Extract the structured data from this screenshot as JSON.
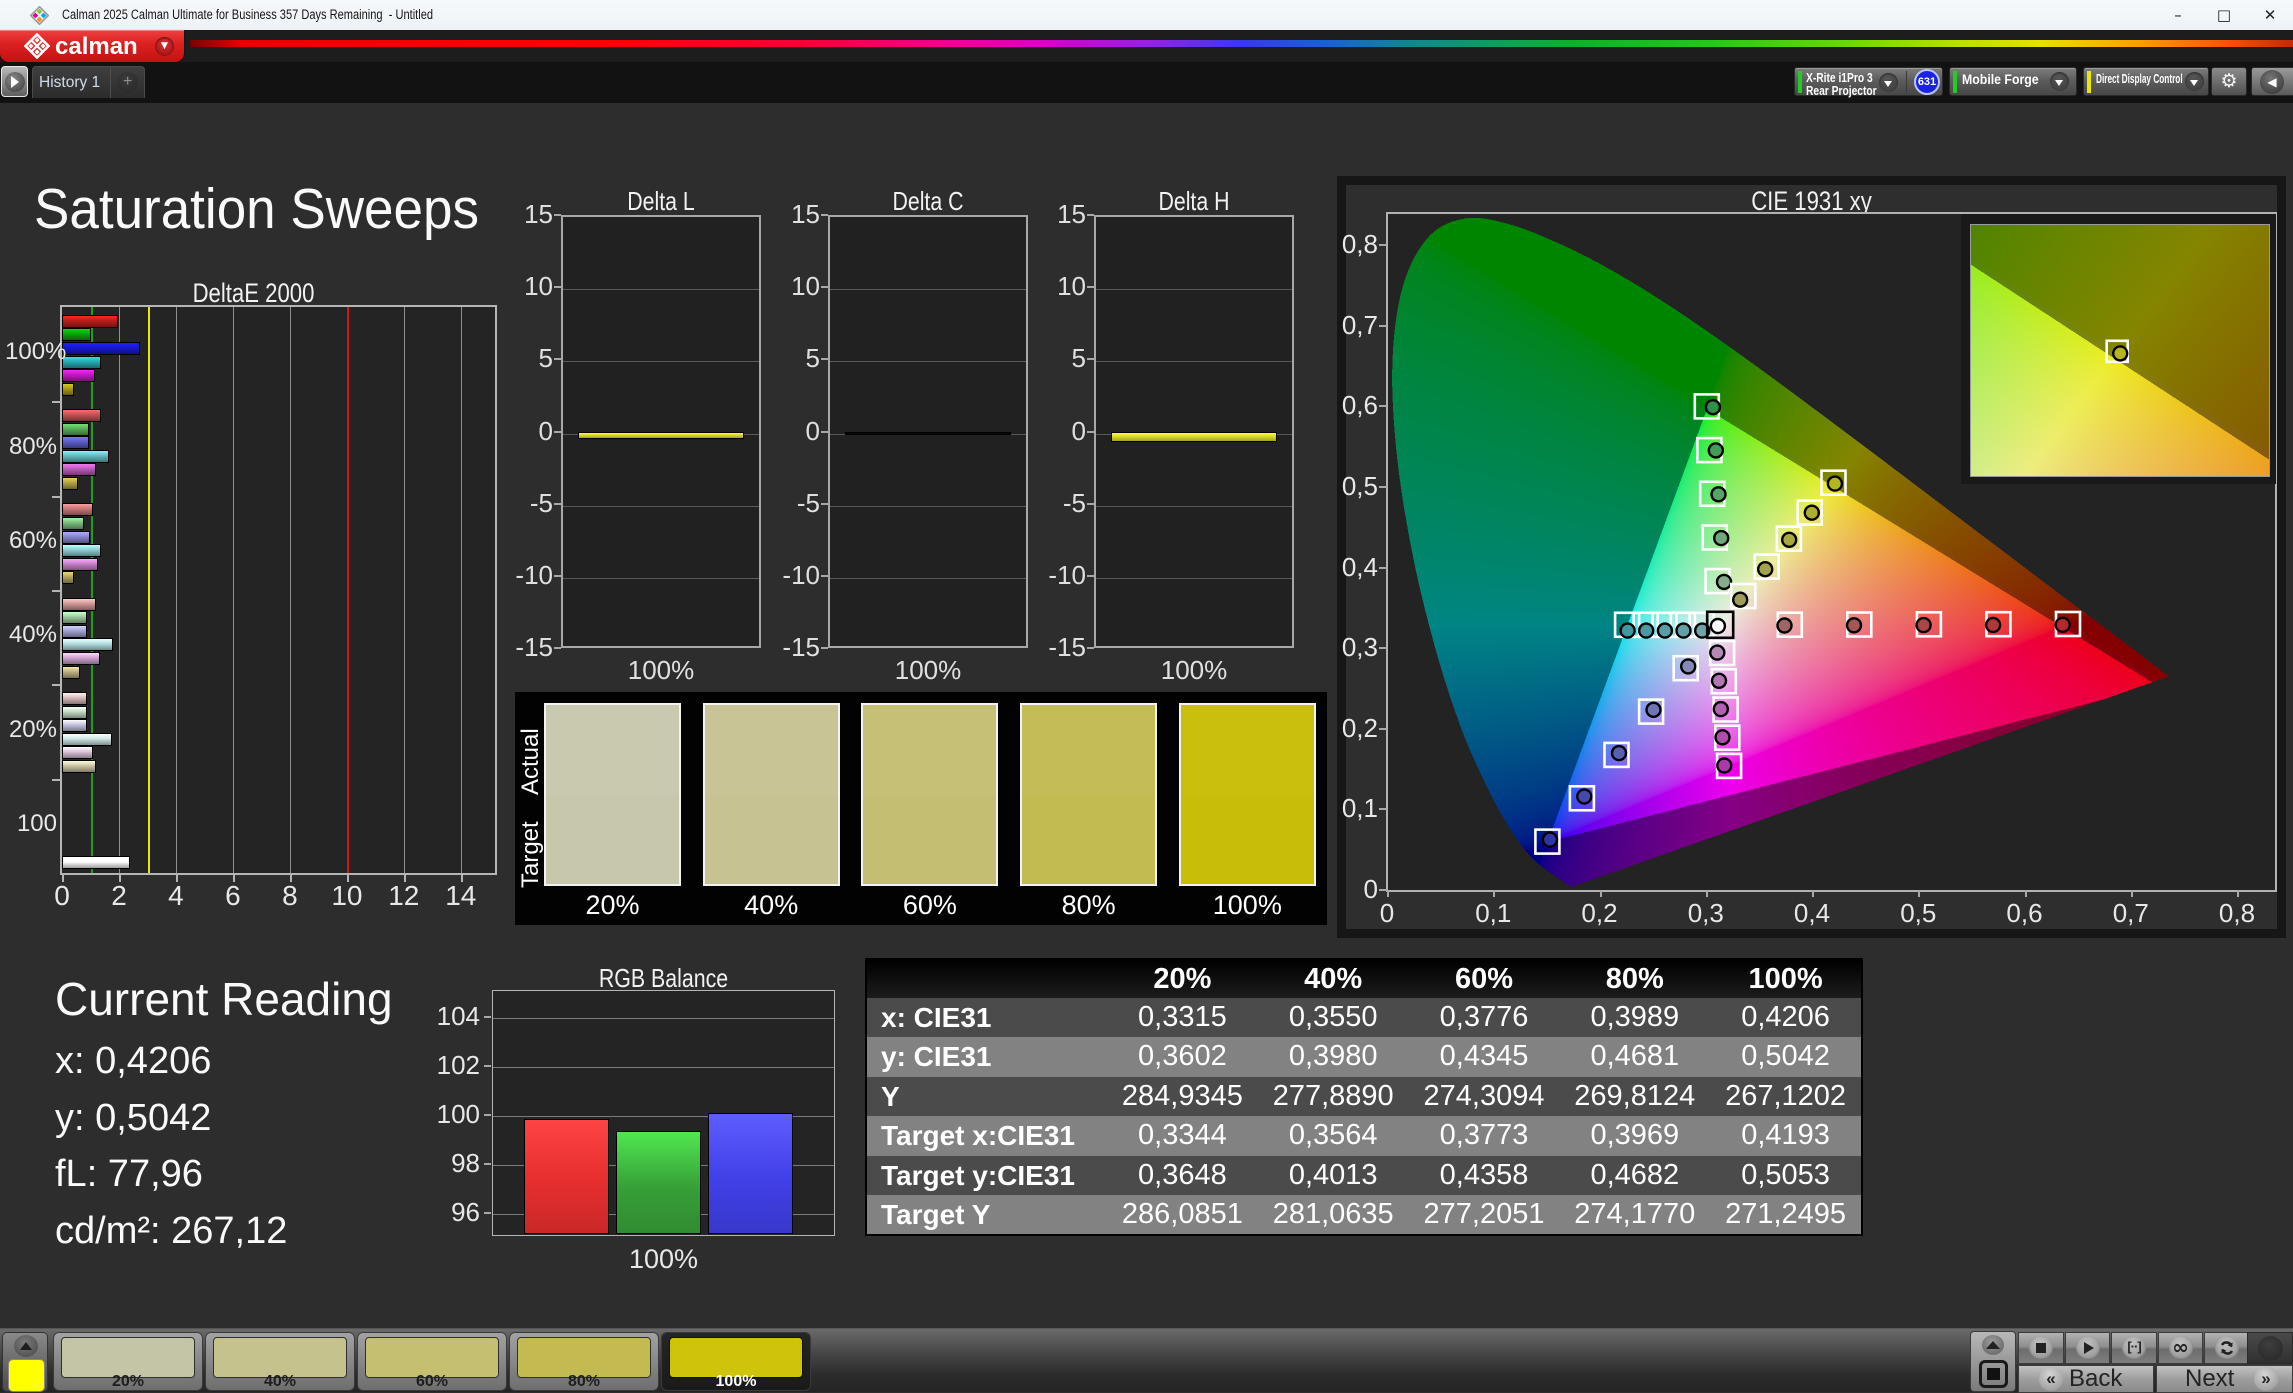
{
  "window": {
    "title": "Calman 2025 Calman Ultimate for Business 357 Days Remaining  - Untitled",
    "controls": [
      {
        "name": "minimize",
        "glyph": "–"
      },
      {
        "name": "maximize",
        "glyph": "□"
      },
      {
        "name": "close",
        "glyph": "✕"
      }
    ]
  },
  "brand": {
    "label": "calman"
  },
  "tabs": {
    "history": "History 1",
    "add": "+"
  },
  "toolbar": {
    "meter": {
      "line1": "X-Rite i1Pro 3",
      "line2": "Rear Projector",
      "status_color": "#22cc22"
    },
    "badge": "631",
    "source": {
      "label": "Mobile Forge",
      "status_color": "#22cc22"
    },
    "display_control": {
      "label": "Direct Display Control",
      "status_color": "#e8e800"
    }
  },
  "page": {
    "title": "Saturation Sweeps"
  },
  "reading": {
    "title": "Current Reading",
    "lines": [
      "x: 0,4206",
      "y: 0,5042",
      "fL: 77,96",
      "cd/m²: 267,12"
    ]
  },
  "chart_data": [
    {
      "id": "deltae2000",
      "type": "bar",
      "title": "DeltaE 2000",
      "orientation": "horizontal",
      "xlim": [
        0,
        15.2
      ],
      "xticks": [
        0,
        2,
        4,
        6,
        8,
        10,
        12,
        14
      ],
      "reference_lines": [
        {
          "value": 1,
          "color": "#1ca01c"
        },
        {
          "value": 3,
          "color": "#e8e800"
        },
        {
          "value": 10,
          "color": "#d01616"
        }
      ],
      "groups": [
        {
          "label": "100%",
          "values": [
            1.95,
            1.0,
            2.75,
            1.38,
            1.15,
            0.42
          ],
          "colors": [
            "#c01d1d",
            "#0ca40c",
            "#1818d0",
            "#28aab2",
            "#bd1dbd",
            "#a89c14"
          ]
        },
        {
          "label": "80%",
          "values": [
            1.35,
            0.93,
            0.93,
            1.64,
            1.2,
            0.55
          ],
          "colors": [
            "#c25353",
            "#58ae58",
            "#5c5cc8",
            "#63bdc2",
            "#bc5cbc",
            "#b3a242"
          ]
        },
        {
          "label": "60%",
          "values": [
            1.1,
            0.78,
            0.99,
            1.35,
            1.27,
            0.42
          ],
          "colors": [
            "#c87878",
            "#7cbc7c",
            "#8686cf",
            "#8fd0d3",
            "#c983c9",
            "#b5a75e"
          ]
        },
        {
          "label": "40%",
          "values": [
            1.19,
            0.88,
            0.86,
            1.79,
            1.32,
            0.62
          ],
          "colors": [
            "#cf9898",
            "#9ecb9e",
            "#a3a3d6",
            "#b4dee0",
            "#d3a6d3",
            "#bdb283"
          ]
        },
        {
          "label": "20%",
          "values": [
            0.89,
            0.86,
            0.89,
            1.76,
            1.07,
            1.19
          ],
          "colors": [
            "#d9bcbc",
            "#c2dbc2",
            "#c3c3e0",
            "#cfe8e8",
            "#dcc5dc",
            "#cdc5a4"
          ]
        },
        {
          "label": "100",
          "values": [
            2.37
          ],
          "colors": [
            "#ffffff"
          ]
        }
      ]
    },
    {
      "id": "delta_l",
      "type": "bar",
      "title": "Delta L",
      "categories": [
        "100%"
      ],
      "values": [
        -0.5
      ],
      "bar_color": "#cbcb2a",
      "ylim": [
        -15,
        15
      ],
      "yticks": [
        15,
        10,
        5,
        0,
        -5,
        -10,
        -15
      ]
    },
    {
      "id": "delta_c",
      "type": "bar",
      "title": "Delta C",
      "categories": [
        "100%"
      ],
      "values": [
        -0.07
      ],
      "bar_color": "#0a0a0a",
      "ylim": [
        -15,
        15
      ],
      "yticks": [
        15,
        10,
        5,
        0,
        -5,
        -10,
        -15
      ]
    },
    {
      "id": "delta_h",
      "type": "bar",
      "title": "Delta H",
      "categories": [
        "100%"
      ],
      "values": [
        -0.72
      ],
      "bar_color": "#cbcb2a",
      "ylim": [
        -15,
        15
      ],
      "yticks": [
        15,
        10,
        5,
        0,
        -5,
        -10,
        -15
      ]
    },
    {
      "id": "cie",
      "type": "scatter",
      "title": "CIE 1931 xy",
      "xticks": [
        "0",
        "0,1",
        "0,2",
        "0,3",
        "0,4",
        "0,5",
        "0,6",
        "0,7",
        "0,8"
      ],
      "yticks": [
        "0",
        "0,1",
        "0,2",
        "0,3",
        "0,4",
        "0,5",
        "0,6",
        "0,7",
        "0,8"
      ],
      "white_point": {
        "target": [
          0.3127,
          0.329
        ],
        "measured": [
          0.3105,
          0.3275
        ],
        "fill": "#ffffff"
      },
      "gamut_triangle": [
        [
          0.3,
          0.597
        ],
        [
          0.15,
          0.06
        ],
        [
          0.724,
          0.254
        ]
      ],
      "sweeps": [
        {
          "name": "red",
          "primary": [
            0.64,
            0.33
          ],
          "targets": [
            [
              0.3782,
              0.3292
            ],
            [
              0.4436,
              0.3294
            ],
            [
              0.5091,
              0.3296
            ],
            [
              0.5745,
              0.3298
            ],
            [
              0.64,
              0.33
            ]
          ],
          "measured": [
            [
              0.3732,
              0.3282
            ],
            [
              0.4386,
              0.3284
            ],
            [
              0.5041,
              0.3286
            ],
            [
              0.5695,
              0.3288
            ],
            [
              0.635,
              0.329
            ]
          ],
          "dot_colors": [
            "#a06666",
            "#a65656",
            "#ab4646",
            "#b03838",
            "#b42a2a"
          ]
        },
        {
          "name": "green",
          "primary": [
            0.3,
            0.6
          ],
          "targets": [
            [
              0.3102,
              0.3832
            ],
            [
              0.3076,
              0.4374
            ],
            [
              0.3051,
              0.4916
            ],
            [
              0.3025,
              0.5458
            ],
            [
              0.3,
              0.6
            ]
          ],
          "measured": [
            [
              0.3162,
              0.3822
            ],
            [
              0.3136,
              0.4366
            ],
            [
              0.3111,
              0.491
            ],
            [
              0.3085,
              0.5454
            ],
            [
              0.3058,
              0.599
            ]
          ],
          "dot_colors": [
            "#84ad8c",
            "#6fa87a",
            "#58a367",
            "#459c56",
            "#2f9246"
          ]
        },
        {
          "name": "blue",
          "primary": [
            0.15,
            0.06
          ],
          "targets": [
            [
              0.2802,
              0.2752
            ],
            [
              0.2476,
              0.2214
            ],
            [
              0.2151,
              0.1676
            ],
            [
              0.1825,
              0.1138
            ],
            [
              0.15,
              0.06
            ]
          ],
          "measured": [
            [
              0.2825,
              0.2774
            ],
            [
              0.2499,
              0.2236
            ],
            [
              0.2174,
              0.1698
            ],
            [
              0.1848,
              0.116
            ],
            [
              0.1525,
              0.0625
            ]
          ],
          "dot_colors": [
            "#8489b8",
            "#6f74b4",
            "#5a60b0",
            "#4549ab",
            "#3136a6"
          ]
        },
        {
          "name": "cyan",
          "primary": [
            0.225,
            0.329
          ],
          "targets": [
            [
              0.2952,
              0.329
            ],
            [
              0.2776,
              0.329
            ],
            [
              0.2601,
              0.329
            ],
            [
              0.2425,
              0.329
            ],
            [
              0.225,
              0.329
            ]
          ],
          "measured": [
            [
              0.2957,
              0.3218
            ],
            [
              0.2781,
              0.3218
            ],
            [
              0.2606,
              0.3218
            ],
            [
              0.243,
              0.3218
            ],
            [
              0.2255,
              0.3218
            ]
          ],
          "dot_colors": [
            "#6fa3a8",
            "#63a0a6",
            "#579da4",
            "#4b9aa2",
            "#3f97a0"
          ]
        },
        {
          "name": "magenta",
          "primary": [
            0.321,
            0.154
          ],
          "targets": [
            [
              0.3144,
              0.294
            ],
            [
              0.316,
              0.259
            ],
            [
              0.3177,
              0.224
            ],
            [
              0.3193,
              0.189
            ],
            [
              0.321,
              0.154
            ]
          ],
          "measured": [
            [
              0.3099,
              0.2945
            ],
            [
              0.3115,
              0.2595
            ],
            [
              0.3132,
              0.2245
            ],
            [
              0.3148,
              0.1895
            ],
            [
              0.3165,
              0.1545
            ]
          ],
          "dot_colors": [
            "#b48ab4",
            "#b276b2",
            "#b062b0",
            "#ae4ead",
            "#ac39a9"
          ]
        },
        {
          "name": "yellow",
          "primary": [
            0.4193,
            0.5053
          ],
          "targets": [
            [
              0.3344,
              0.3648
            ],
            [
              0.3564,
              0.4013
            ],
            [
              0.3773,
              0.4358
            ],
            [
              0.3969,
              0.4682
            ],
            [
              0.4193,
              0.5053
            ]
          ],
          "measured": [
            [
              0.3315,
              0.3602
            ],
            [
              0.355,
              0.398
            ],
            [
              0.3776,
              0.4345
            ],
            [
              0.3989,
              0.4681
            ],
            [
              0.4206,
              0.5042
            ]
          ],
          "dot_colors": [
            "#9d9d58",
            "#a3a34b",
            "#a8a83e",
            "#aeae30",
            "#b5b520"
          ]
        }
      ],
      "inset": {
        "x_range": [
          0.3555,
          0.4855
        ],
        "y_range": [
          0.438,
          0.5735
        ],
        "target": [
          0.4193,
          0.5053
        ],
        "measured": [
          0.4206,
          0.5042
        ]
      }
    },
    {
      "id": "swatches",
      "type": "table",
      "row_labels": [
        "Actual",
        "Target"
      ],
      "categories": [
        "20%",
        "40%",
        "60%",
        "80%",
        "100%"
      ],
      "actual_colors": [
        "#c9c9b0",
        "#c8c496",
        "#c6c077",
        "#c4bd57",
        "#cabf0c"
      ],
      "target_colors": [
        "#c7c7ac",
        "#c6c292",
        "#c4be73",
        "#c2bb52",
        "#c8bd08"
      ]
    },
    {
      "id": "rgb_balance",
      "type": "bar",
      "title": "RGB Balance",
      "categories": [
        "100%"
      ],
      "series": [
        {
          "name": "Red",
          "values": [
            99.9
          ],
          "color": "#e62e2e"
        },
        {
          "name": "Green",
          "values": [
            99.4
          ],
          "color": "#379f37"
        },
        {
          "name": "Blue",
          "values": [
            100.15
          ],
          "color": "#4040e8"
        }
      ],
      "ylim": [
        95.2,
        105.1
      ],
      "yticks": [
        104,
        102,
        100,
        98,
        96
      ]
    },
    {
      "id": "data_table",
      "type": "table",
      "columns": [
        "",
        "20%",
        "40%",
        "60%",
        "80%",
        "100%"
      ],
      "rows": [
        {
          "label": "x: CIE31",
          "values": [
            "0,3315",
            "0,3550",
            "0,3776",
            "0,3989",
            "0,4206"
          ]
        },
        {
          "label": "y: CIE31",
          "values": [
            "0,3602",
            "0,3980",
            "0,4345",
            "0,4681",
            "0,5042"
          ]
        },
        {
          "label": "Y",
          "values": [
            "284,9345",
            "277,8890",
            "274,3094",
            "269,8124",
            "267,1202"
          ]
        },
        {
          "label": "Target x:CIE31",
          "values": [
            "0,3344",
            "0,3564",
            "0,3773",
            "0,3969",
            "0,4193"
          ]
        },
        {
          "label": "Target y:CIE31",
          "values": [
            "0,3648",
            "0,4013",
            "0,4358",
            "0,4682",
            "0,5053"
          ]
        },
        {
          "label": "Target Y",
          "values": [
            "286,0851",
            "281,0635",
            "277,2051",
            "274,1770",
            "271,2495"
          ]
        }
      ]
    }
  ],
  "bottom": {
    "patch_color": "#ffff00",
    "slides": [
      {
        "label": "20%",
        "color": "#c4c4a7",
        "selected": false
      },
      {
        "label": "40%",
        "color": "#c5c28e",
        "selected": false
      },
      {
        "label": "60%",
        "color": "#c5bf72",
        "selected": false
      },
      {
        "label": "80%",
        "color": "#c3bb52",
        "selected": false
      },
      {
        "label": "100%",
        "color": "#cfc409",
        "selected": true
      }
    ],
    "transport": [
      "stop",
      "play",
      "range",
      "loop",
      "refresh"
    ],
    "back_label": "Back",
    "next_label": "Next"
  }
}
